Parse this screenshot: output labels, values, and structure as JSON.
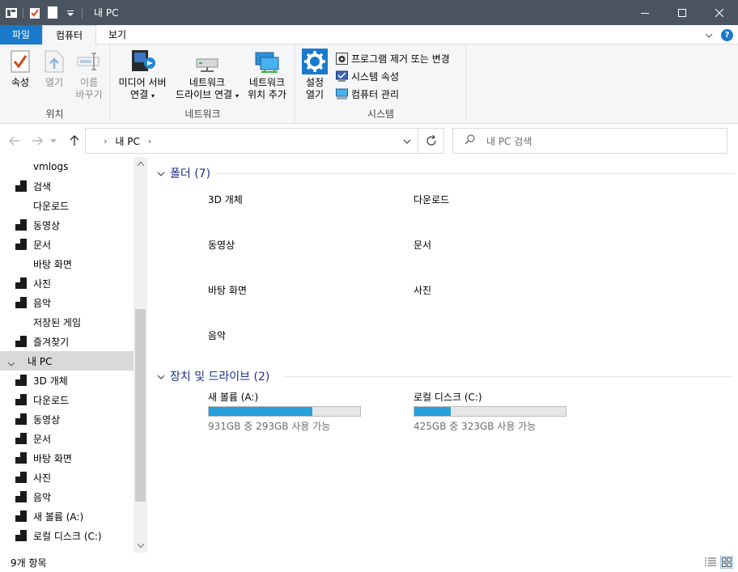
{
  "window": {
    "title": "내 PC"
  },
  "tabs": {
    "file": "파일",
    "computer": "컴퓨터",
    "view": "보기"
  },
  "ribbon": {
    "location": {
      "label": "위치",
      "properties": "속성",
      "open": "열기",
      "rename_1": "이름",
      "rename_2": "바꾸기"
    },
    "network": {
      "label": "네트워크",
      "media_1": "미디어 서버",
      "media_2": "연결",
      "map_1": "네트워크",
      "map_2": "드라이브 연결",
      "add_1": "네트워크",
      "add_2": "위치 추가"
    },
    "system": {
      "label": "시스템",
      "settings_1": "설정",
      "settings_2": "열기",
      "uninstall": "프로그램 제거 또는 변경",
      "sysprops": "시스템 속성",
      "manage": "컴퓨터 관리"
    }
  },
  "address": {
    "path": "내 PC"
  },
  "search": {
    "placeholder": "내 PC 검색"
  },
  "nav": {
    "items": [
      {
        "label": "vmlogs",
        "pinned": false
      },
      {
        "label": "검색",
        "pinned": true
      },
      {
        "label": "다운로드",
        "pinned": false
      },
      {
        "label": "동영상",
        "pinned": true
      },
      {
        "label": "문서",
        "pinned": true
      },
      {
        "label": "바탕 화면",
        "pinned": false
      },
      {
        "label": "사진",
        "pinned": true
      },
      {
        "label": "음악",
        "pinned": true
      },
      {
        "label": "저장된 게임",
        "pinned": false
      },
      {
        "label": "즐겨찾기",
        "pinned": true
      },
      {
        "label": "내 PC",
        "pinned": false
      },
      {
        "label": "3D 개체",
        "pinned": true
      },
      {
        "label": "다운로드",
        "pinned": true
      },
      {
        "label": "동영상",
        "pinned": true
      },
      {
        "label": "문서",
        "pinned": true
      },
      {
        "label": "바탕 화면",
        "pinned": true
      },
      {
        "label": "사진",
        "pinned": true
      },
      {
        "label": "음악",
        "pinned": true
      },
      {
        "label": "새 볼륨 (A:)",
        "pinned": true
      },
      {
        "label": "로컬 디스크 (C:)",
        "pinned": true
      }
    ]
  },
  "content": {
    "folders_header": "폴더 (7)",
    "folders": [
      "3D 개체",
      "다운로드",
      "동영상",
      "문서",
      "바탕 화면",
      "사진",
      "음악"
    ],
    "drives_header": "장치 및 드라이브 (2)",
    "drives": [
      {
        "name": "새 볼륨 (A:)",
        "info": "931GB 중 293GB 사용 가능",
        "used_fraction": 0.685
      },
      {
        "name": "로컬 디스크 (C:)",
        "info": "425GB 중 323GB 사용 가능",
        "used_fraction": 0.24
      }
    ]
  },
  "status": {
    "count": "9개 항목"
  },
  "colors": {
    "accent": "#1979ca",
    "drive_bar": "#26a0da",
    "titlebar": "#4a5461"
  }
}
